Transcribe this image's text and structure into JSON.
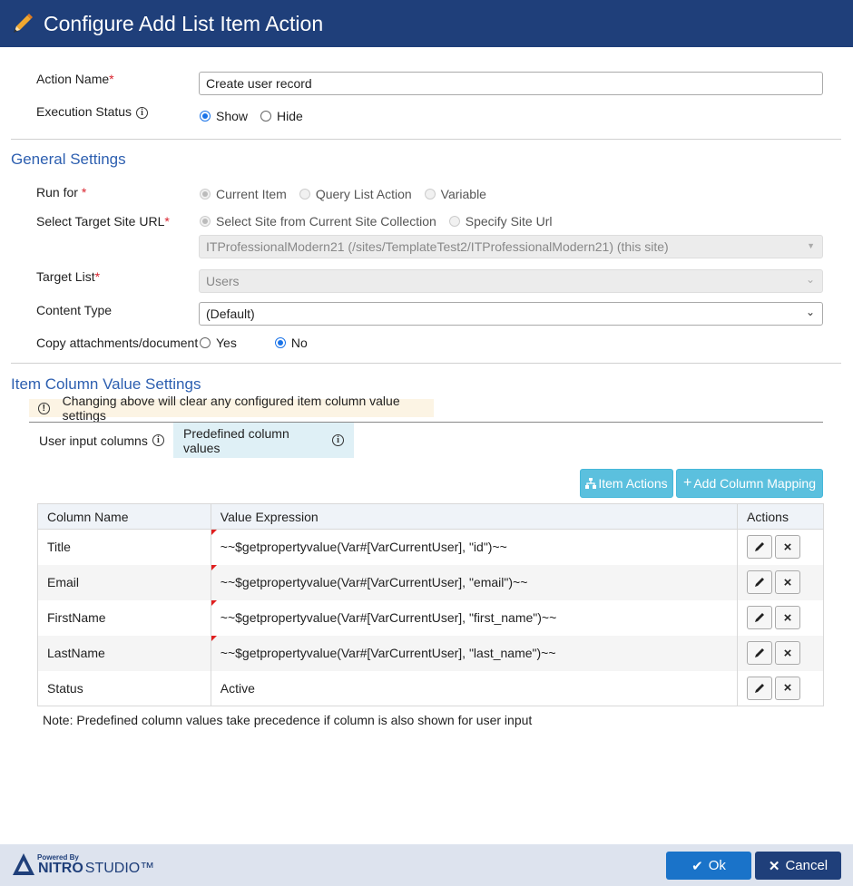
{
  "header": {
    "title": "Configure Add List Item Action"
  },
  "action_name": {
    "label": "Action Name",
    "required_mark": "*",
    "value": "Create user record"
  },
  "execution_status": {
    "label": "Execution Status",
    "options": [
      "Show",
      "Hide"
    ],
    "selected": "Show"
  },
  "general_settings": {
    "title": "General Settings",
    "run_for": {
      "label": "Run for ",
      "required_mark": "*",
      "options": [
        "Current Item",
        "Query List Action",
        "Variable"
      ],
      "selected": "Current Item"
    },
    "target_site": {
      "label": "Select Target Site URL",
      "required_mark": "*",
      "options": [
        "Select Site from Current Site Collection",
        "Specify Site Url"
      ],
      "selected": "Select Site from Current Site Collection",
      "site_value": "ITProfessionalModern21 (/sites/TemplateTest2/ITProfessionalModern21) (this site)"
    },
    "target_list": {
      "label": "Target List",
      "required_mark": "*",
      "value": "Users"
    },
    "content_type": {
      "label": "Content Type",
      "value": "(Default)"
    },
    "copy_attachments": {
      "label": "Copy attachments/document",
      "options": [
        "Yes",
        "No"
      ],
      "selected": "No"
    }
  },
  "item_column_settings": {
    "title": "Item Column Value Settings",
    "notice": "Changing above will clear any configured item column value settings",
    "tabs": [
      "User input columns",
      "Predefined column values"
    ],
    "active_tab": "Predefined column values",
    "buttons": {
      "item_actions": "Item Actions",
      "add_mapping": "Add Column Mapping"
    },
    "table": {
      "headers": [
        "Column Name",
        "Value Expression",
        "Actions"
      ],
      "rows": [
        {
          "column": "Title",
          "expression": "~~$getpropertyvalue(Var#[VarCurrentUser], \"id\")~~"
        },
        {
          "column": "Email",
          "expression": "~~$getpropertyvalue(Var#[VarCurrentUser], \"email\")~~"
        },
        {
          "column": "FirstName",
          "expression": "~~$getpropertyvalue(Var#[VarCurrentUser], \"first_name\")~~"
        },
        {
          "column": "LastName",
          "expression": "~~$getpropertyvalue(Var#[VarCurrentUser], \"last_name\")~~"
        },
        {
          "column": "Status",
          "expression": "Active"
        }
      ]
    },
    "note": "Note: Predefined column values take precedence if column is also shown for user input"
  },
  "footer": {
    "logo": {
      "powered_by": "Powered By",
      "brand": "NITRO",
      "brand2": "STUDIO™"
    },
    "ok_label": "Ok",
    "cancel_label": "Cancel"
  },
  "colors": {
    "header_bg": "#1f3f7a",
    "accent_blue": "#2d5fb0",
    "teal_button": "#5bc0de",
    "ok_button": "#1a73c9",
    "cancel_button": "#1f3f7a",
    "required": "#d9232e"
  }
}
